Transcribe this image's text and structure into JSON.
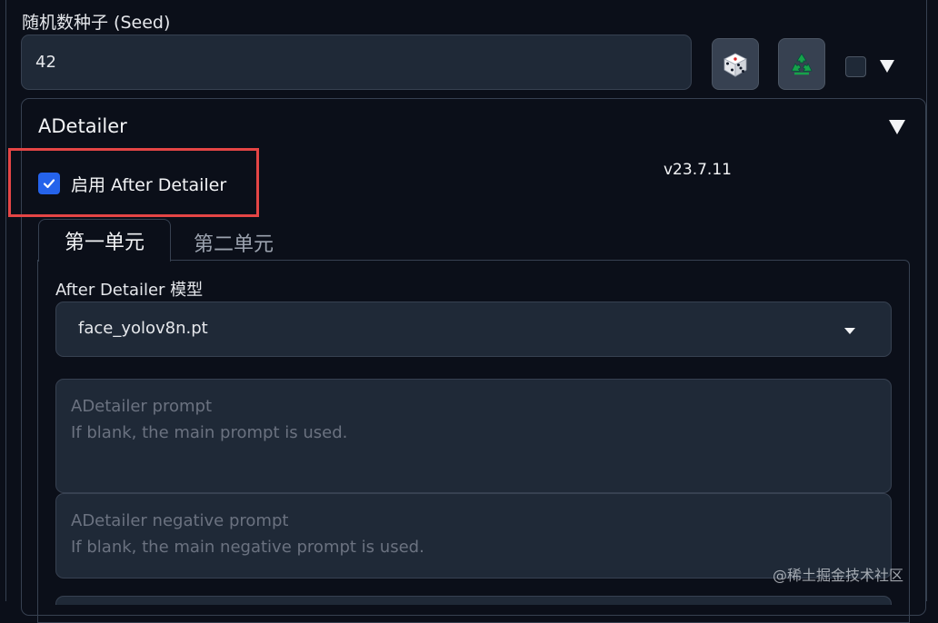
{
  "seed": {
    "label": "随机数种子 (Seed)",
    "value": "42",
    "dice_icon": "dice-icon",
    "recycle_icon": "recycle-icon",
    "extra_checked": false
  },
  "adetailer": {
    "title": "ADetailer",
    "enable_label": "启用 After Detailer",
    "enabled": true,
    "version": "v23.7.11",
    "tabs": [
      {
        "label": "第一单元",
        "active": true
      },
      {
        "label": "第二单元",
        "active": false
      }
    ],
    "model_label": "After Detailer 模型",
    "model_value": "face_yolov8n.pt",
    "prompt_title": "ADetailer prompt",
    "prompt_placeholder": "If blank, the main prompt is used.",
    "neg_prompt_title": "ADetailer negative prompt",
    "neg_prompt_placeholder": "If blank, the main negative prompt is used."
  },
  "watermark": "@稀土掘金技术社区",
  "colors": {
    "background": "#0b0f19",
    "input_bg": "#1f2937",
    "border": "#374151",
    "checkbox_accent": "#2563eb",
    "highlight": "#e54545",
    "recycle_green": "#16a34a"
  }
}
